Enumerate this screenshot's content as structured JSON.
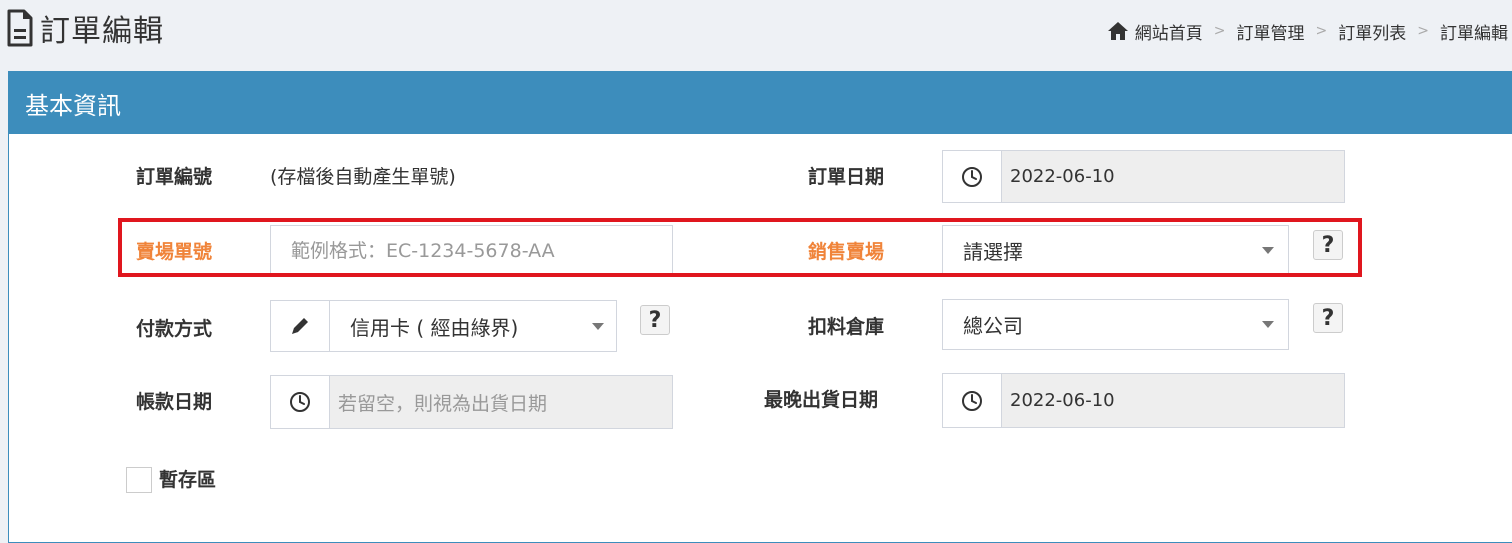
{
  "header": {
    "page_title": "訂單編輯",
    "breadcrumb": [
      "網站首頁",
      "訂單管理",
      "訂單列表",
      "訂單編輯"
    ]
  },
  "panel": {
    "title": "基本資訊"
  },
  "form": {
    "order_no": {
      "label": "訂單編號",
      "value": "(存檔後自動產生單號)"
    },
    "order_date": {
      "label": "訂單日期",
      "value": "2022-06-10"
    },
    "store_order_no": {
      "label": "賣場單號",
      "placeholder": "範例格式：EC-1234-5678-AA"
    },
    "sales_store": {
      "label": "銷售賣場",
      "value": "請選擇",
      "help": "?"
    },
    "payment_method": {
      "label": "付款方式",
      "value": "信用卡 ( 經由綠界)",
      "help": "?"
    },
    "warehouse": {
      "label": "扣料倉庫",
      "value": "總公司",
      "help": "?"
    },
    "account_date": {
      "label": "帳款日期",
      "placeholder": "若留空，則視為出貨日期"
    },
    "latest_ship_date": {
      "label": "最晚出貨日期",
      "value": "2022-06-10"
    },
    "draft": {
      "label": "暫存區",
      "checked": false
    }
  },
  "colors": {
    "panel_header": "#3d8dbc",
    "highlight_label": "#f0843a",
    "highlight_border": "#e0161e",
    "page_bg": "#eef1f5"
  },
  "icons": {
    "title": "document-icon",
    "breadcrumb_home": "home-icon",
    "date_addon": "clock-icon",
    "payment_addon": "pencil-icon",
    "dropdown": "caret-down-icon"
  }
}
